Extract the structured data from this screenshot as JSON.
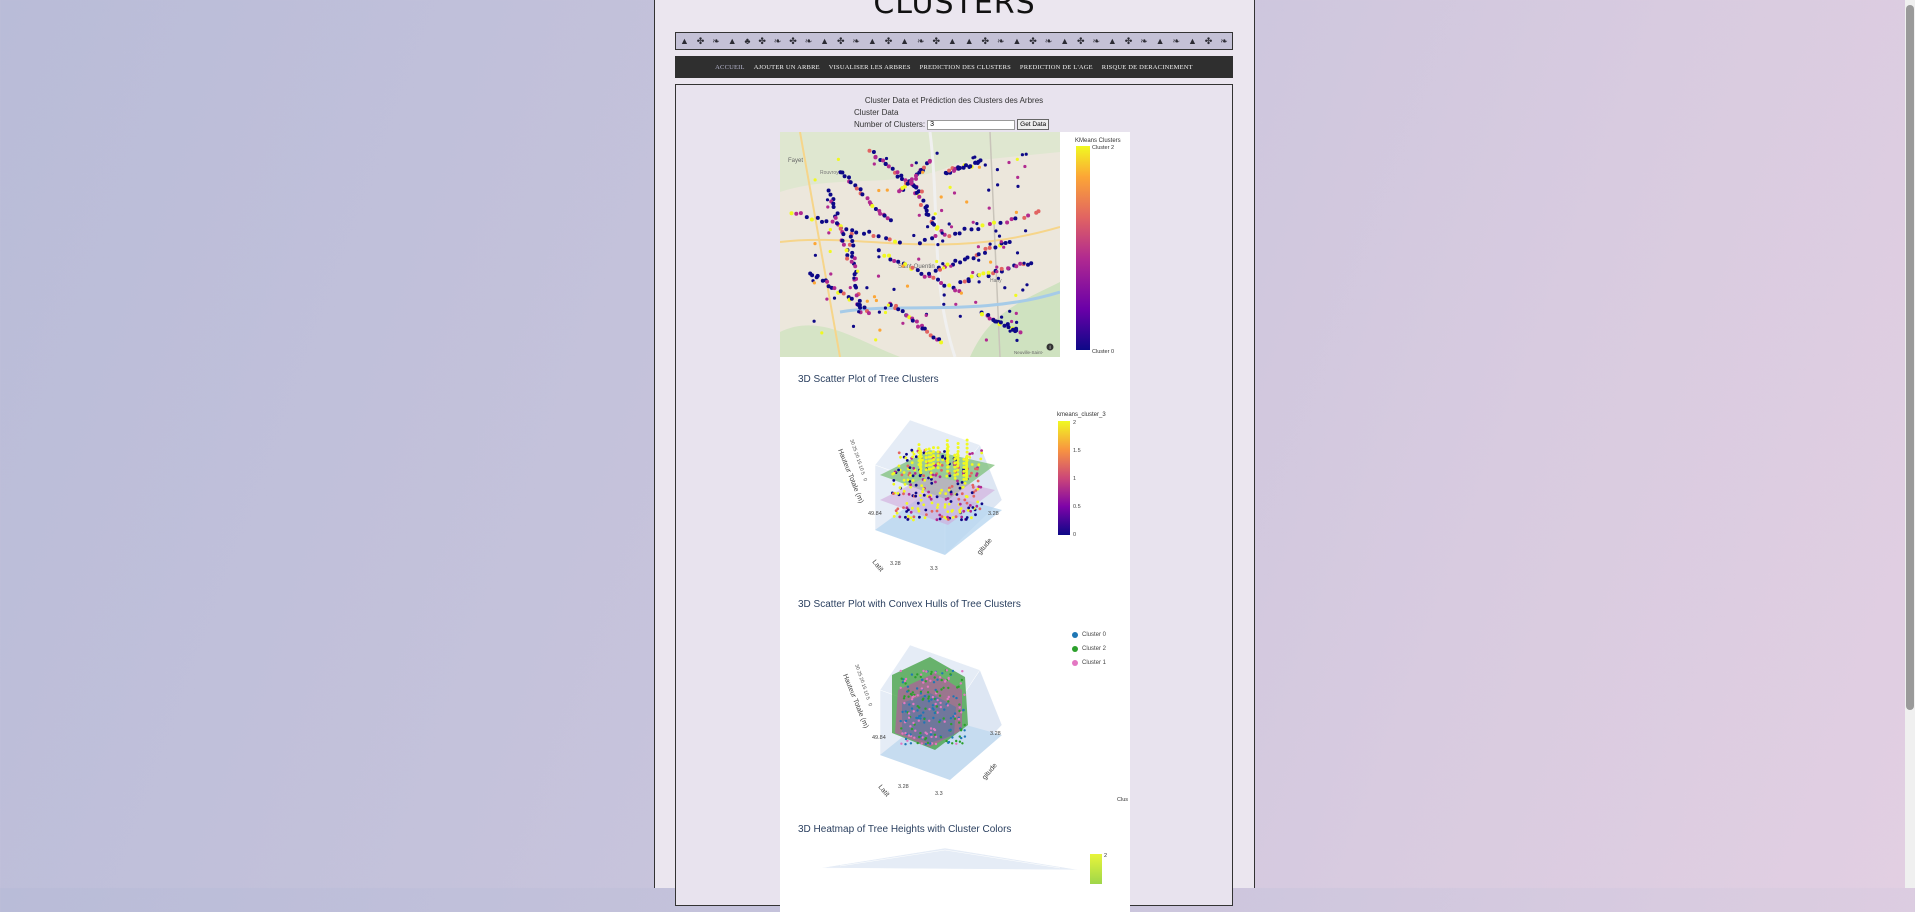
{
  "page_title": "CLUSTERS",
  "icon_band": [
    "bell-icon",
    "sprout-icon",
    "leaf-icon",
    "bell-icon",
    "tree-icon",
    "sprout-icon",
    "leaf-icon",
    "sprout-icon",
    "leaf-icon",
    "bell-icon",
    "sprout-icon",
    "leaf-icon",
    "bell-icon",
    "sprout-icon",
    "bell-icon",
    "leaf-icon",
    "sprout-icon",
    "bell-icon",
    "bell-icon",
    "sprout-icon",
    "leaf-icon",
    "bell-icon",
    "sprout-icon",
    "leaf-icon",
    "bell-icon",
    "sprout-icon",
    "leaf-icon",
    "bell-icon",
    "sprout-icon",
    "leaf-icon",
    "bell-icon",
    "leaf-icon",
    "bell-icon",
    "sprout-icon",
    "leaf-icon"
  ],
  "nav": {
    "items": [
      {
        "label": "ACCUEIL",
        "active": true
      },
      {
        "label": "AJOUTER UN ARBRE",
        "active": false
      },
      {
        "label": "VISUALISER LES ARBRES",
        "active": false
      },
      {
        "label": "PREDICTION DES CLUSTERS",
        "active": false
      },
      {
        "label": "PREDICTION DE L'AGE",
        "active": false
      },
      {
        "label": "RISQUE DE DERACINEMENT",
        "active": false
      }
    ]
  },
  "section": {
    "title": "Cluster Data et Prédiction des Clusters des Arbres",
    "subtitle": "Cluster Data",
    "form": {
      "label": "Number of Clusters:",
      "value": "3",
      "button": "Get Data"
    }
  },
  "map": {
    "colorbar_title": "KMeans Clusters",
    "top_label": "Cluster 2",
    "bottom_label": "Cluster 0",
    "place_labels": [
      "Fayet",
      "Rouvroy",
      "Saint-Quentin",
      "Harly",
      "Neuville-Saint-"
    ],
    "info_icon": "info-icon"
  },
  "scatter3d": {
    "title": "3D Scatter Plot of Tree Clusters",
    "colorbar_title": "kmeans_cluster_3",
    "colorbar_ticks": [
      "2",
      "1.5",
      "1",
      "0.5",
      "0"
    ],
    "axis_z": "Hauteur Totale (m)",
    "axis_y": "Latit",
    "axis_x": "gitude",
    "tick_left": [
      "0.08",
      "49.84"
    ],
    "tick_bottom": [
      "3.28",
      "3.3"
    ],
    "tick_right": "3.28",
    "z_ticks": [
      "30",
      "25",
      "20",
      "15",
      "10",
      "5",
      "0"
    ]
  },
  "hull3d": {
    "title": "3D Scatter Plot with Convex Hulls of Tree Clusters",
    "legend": [
      {
        "label": "Cluster 0",
        "color": "#1f77b4"
      },
      {
        "label": "Cluster 2",
        "color": "#2ca02c"
      },
      {
        "label": "Cluster 1",
        "color": "#e377c2"
      }
    ],
    "axis_z": "Hauteur Totale (m)",
    "axis_y": "Latit",
    "axis_x": "gitude",
    "tick_left": [
      "0.08",
      "49.84"
    ],
    "tick_bottom": [
      "3.28",
      "3.3"
    ],
    "tick_right": "3.28",
    "z_ticks": [
      "30",
      "25",
      "20",
      "15",
      "10",
      "5",
      "0"
    ],
    "corner_label": "Clus"
  },
  "heatmap3d": {
    "title": "3D Heatmap of Tree Heights with Cluster Colors",
    "colorbar_top": "2"
  },
  "colors": {
    "plasma": [
      "#0d0887",
      "#6a00a8",
      "#b12a90",
      "#e16462",
      "#fca636",
      "#f0f921"
    ],
    "nav_bg": "#2f2f2f",
    "plot_title": "#2a3f5f"
  }
}
